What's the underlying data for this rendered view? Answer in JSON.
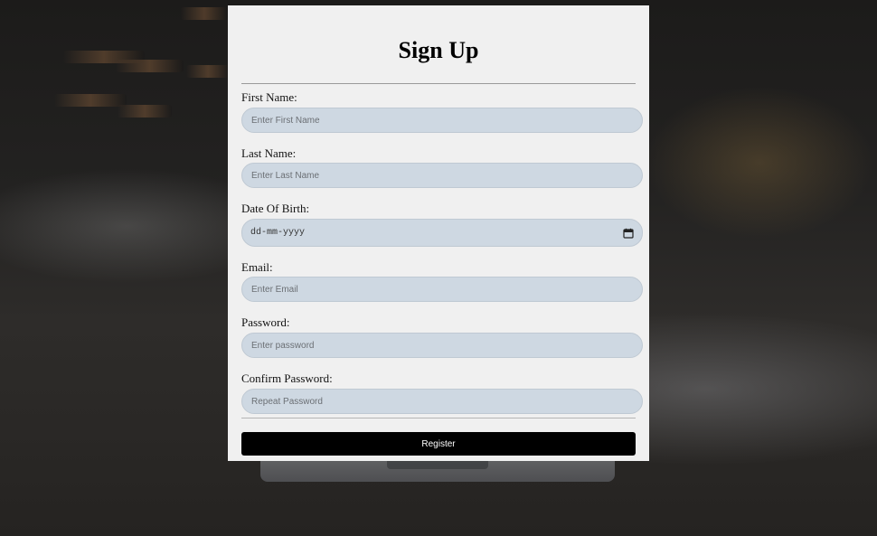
{
  "form": {
    "title": "Sign Up",
    "fields": [
      {
        "label": "First Name:",
        "placeholder": "Enter First Name",
        "value": ""
      },
      {
        "label": "Last Name:",
        "placeholder": "Enter Last Name",
        "value": ""
      },
      {
        "label": "Date Of Birth:",
        "display": "dd-mm-yyyy",
        "value": ""
      },
      {
        "label": "Email:",
        "placeholder": "Enter Email",
        "value": ""
      },
      {
        "label": "Password:",
        "placeholder": "Enter password",
        "value": ""
      },
      {
        "label": "Confirm Password:",
        "placeholder": "Repeat Password",
        "value": ""
      }
    ],
    "register_label": "Register"
  },
  "icons": {
    "date_picker": "calendar-icon"
  },
  "colors": {
    "card_background": "#f0f0f0",
    "input_background": "#ced8e2",
    "button_background": "#000000",
    "button_text": "#ffffff"
  }
}
